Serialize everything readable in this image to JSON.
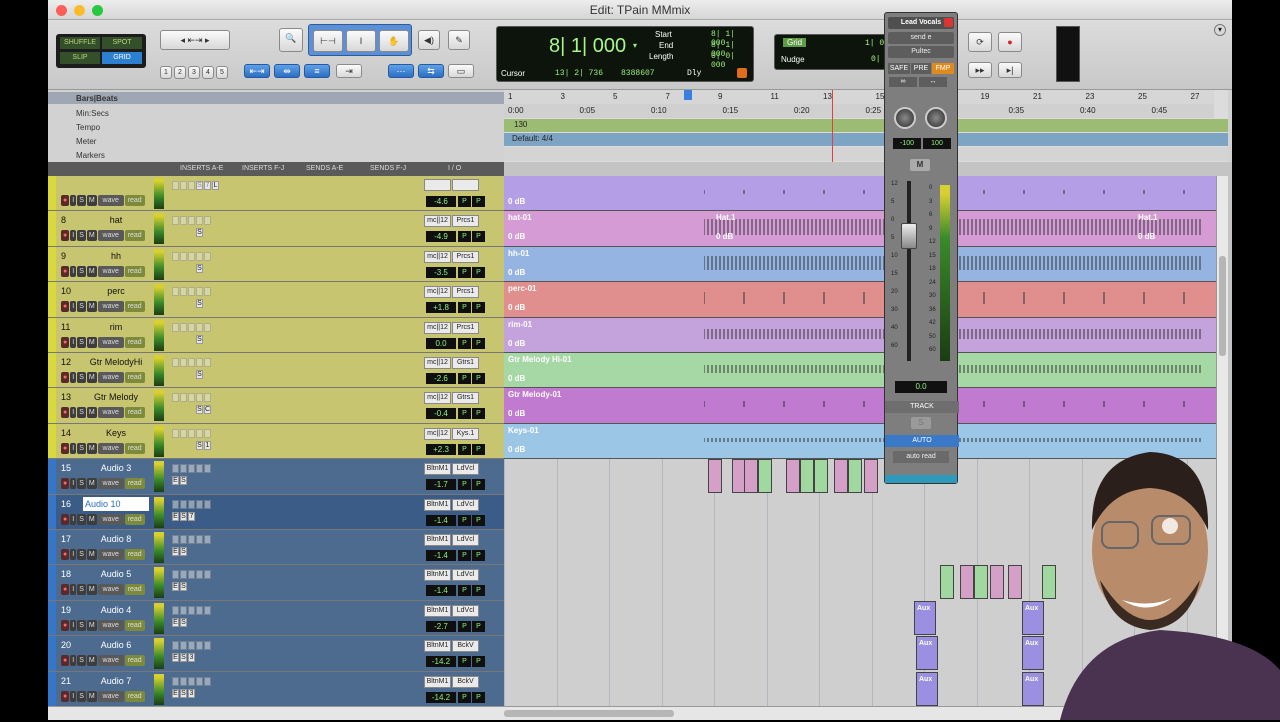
{
  "window": {
    "title": "Edit: TPain MMmix"
  },
  "toolbar": {
    "mode_buttons": [
      "SHUFFLE",
      "SPOT",
      "SLIP",
      "GRID"
    ],
    "zoom_presets": [
      "1",
      "2",
      "3",
      "4",
      "5"
    ],
    "counter_main": "8| 1| 000",
    "start_label": "Start",
    "end_label": "End",
    "length_label": "Length",
    "start_value": "8| 1| 000",
    "end_value": "8| 1| 000",
    "length_value": "0| 0| 000",
    "cursor_label": "Cursor",
    "cursor_value": "13| 2| 736",
    "cursor_sample": "8388607",
    "dly_label": "Dly",
    "grid_label": "Grid",
    "grid_value": "1| 0| 000",
    "nudge_label": "Nudge",
    "nudge_value": "0| 1| 000"
  },
  "rulers": {
    "labels": [
      "Bars|Beats",
      "Min:Secs",
      "Tempo",
      "Meter",
      "Markers"
    ],
    "bar_ticks": [
      "1",
      "3",
      "5",
      "7",
      "9",
      "11",
      "13",
      "15",
      "17",
      "19",
      "21",
      "23",
      "25",
      "27"
    ],
    "sec_ticks": [
      "0:00",
      "0:05",
      "0:10",
      "0:15",
      "0:20",
      "0:25",
      "0:30",
      "0:35",
      "0:40",
      "0:45"
    ],
    "tempo_value": "130",
    "meter_value": "Default: 4/4"
  },
  "columns": [
    "INSERTS A-E",
    "INSERTS F-J",
    "SENDS A-E",
    "SENDS F-J",
    "I / O"
  ],
  "tracks": [
    {
      "num": "",
      "name": "",
      "type": "y",
      "vol": "-4.6",
      "in": "",
      "out": "",
      "clip": "",
      "sel": false,
      "ins": [
        "S",
        "7",
        "L"
      ]
    },
    {
      "num": "8",
      "name": "hat",
      "type": "y",
      "vol": "-4.9",
      "in": "mc||12",
      "out": "Prcs1",
      "clip": "hat-01",
      "sel": false,
      "ins": [
        "S"
      ]
    },
    {
      "num": "9",
      "name": "hh",
      "type": "y",
      "vol": "-3.5",
      "in": "mc||12",
      "out": "Prcs1",
      "clip": "hh-01",
      "sel": false,
      "ins": [
        "S"
      ]
    },
    {
      "num": "10",
      "name": "perc",
      "type": "y",
      "vol": "+1.8",
      "in": "mc||12",
      "out": "Prcs1",
      "clip": "perc-01",
      "sel": false,
      "ins": [
        "S"
      ]
    },
    {
      "num": "11",
      "name": "rim",
      "type": "y",
      "vol": "0.0",
      "in": "mc||12",
      "out": "Prcs1",
      "clip": "rim-01",
      "sel": false,
      "ins": [
        "S"
      ]
    },
    {
      "num": "12",
      "name": "Gtr MelodyHi",
      "type": "y",
      "vol": "-2.6",
      "in": "mc||12",
      "out": "Gtrs1",
      "clip": "Gtr Melody Hi-01",
      "sel": false,
      "ins": [
        "S"
      ]
    },
    {
      "num": "13",
      "name": "Gtr Melody",
      "type": "y",
      "vol": "-0.4",
      "in": "mc||12",
      "out": "Gtrs1",
      "clip": "Gtr Melody-01",
      "sel": false,
      "ins": [
        "S",
        "C"
      ]
    },
    {
      "num": "14",
      "name": "Keys",
      "type": "y",
      "vol": "+2.3",
      "in": "mc||12",
      "out": "Kys.1",
      "clip": "Keys-01",
      "sel": false,
      "ins": [
        "S",
        "1"
      ]
    },
    {
      "num": "15",
      "name": "Audio 3",
      "type": "b",
      "vol": "-1.7",
      "in": "BltnM1",
      "out": "LdVcl",
      "clip": "",
      "sel": false,
      "ins": [
        "E",
        "S"
      ]
    },
    {
      "num": "16",
      "name": "Audio 10",
      "type": "b",
      "vol": "-1.4",
      "in": "BltnM1",
      "out": "LdVcl",
      "clip": "",
      "sel": true,
      "ins": [
        "E",
        "S",
        "7"
      ]
    },
    {
      "num": "17",
      "name": "Audio 8",
      "type": "b",
      "vol": "-1.4",
      "in": "BltnM1",
      "out": "LdVcl",
      "clip": "",
      "sel": false,
      "ins": [
        "E",
        "S"
      ]
    },
    {
      "num": "18",
      "name": "Audio 5",
      "type": "b",
      "vol": "-1.4",
      "in": "BltnM1",
      "out": "LdVcl",
      "clip": "",
      "sel": false,
      "ins": [
        "E",
        "S"
      ]
    },
    {
      "num": "19",
      "name": "Audio 4",
      "type": "b",
      "vol": "-2.7",
      "in": "BltnM1",
      "out": "LdVcl",
      "clip": "",
      "sel": false,
      "ins": [
        "E",
        "S"
      ]
    },
    {
      "num": "20",
      "name": "Audio 6",
      "type": "b",
      "vol": "-14.2",
      "in": "BltnM1",
      "out": "BckV",
      "clip": "",
      "sel": false,
      "ins": [
        "E",
        "S",
        "3"
      ]
    },
    {
      "num": "21",
      "name": "Audio 7",
      "type": "b",
      "vol": "-14.2",
      "in": "BltnM1",
      "out": "BckV",
      "clip": "",
      "sel": false,
      "ins": [
        "E",
        "S",
        "3"
      ]
    }
  ],
  "track_ctrl": {
    "i": "I",
    "s": "S",
    "m": "M",
    "wave": "wave",
    "read": "read",
    "pan": "P"
  },
  "clip_db": "0 dB",
  "hat_clip2": "Hat.1",
  "fader": {
    "track_name": "Lead Vocals",
    "send": "send e",
    "plugin": "Pultec",
    "safe": "SAFE",
    "pre": "PRE",
    "fmp": "FMP",
    "pan_left": "-100",
    "pan_right": "100",
    "mute": "M",
    "value": "0.0",
    "track_label": "TRACK",
    "solo": "S",
    "auto_label": "AUTO",
    "auto_mode": "auto read",
    "scale": [
      "12",
      "5",
      "0",
      "5",
      "10",
      "15",
      "20",
      "30",
      "40",
      "60"
    ],
    "meter_scale": [
      "0",
      "3",
      "6",
      "9",
      "12",
      "15",
      "18",
      "24",
      "30",
      "36",
      "42",
      "50",
      "60"
    ]
  },
  "aux_label": "Aux",
  "colors": {
    "purple": "#b49ee6",
    "pink": "#d49bd4",
    "blue": "#96b4e2",
    "red": "#e08e8e",
    "violet": "#c4a2dc",
    "green": "#a6d8a6",
    "magenta": "#c07ad0",
    "sky": "#9cc6e6"
  }
}
